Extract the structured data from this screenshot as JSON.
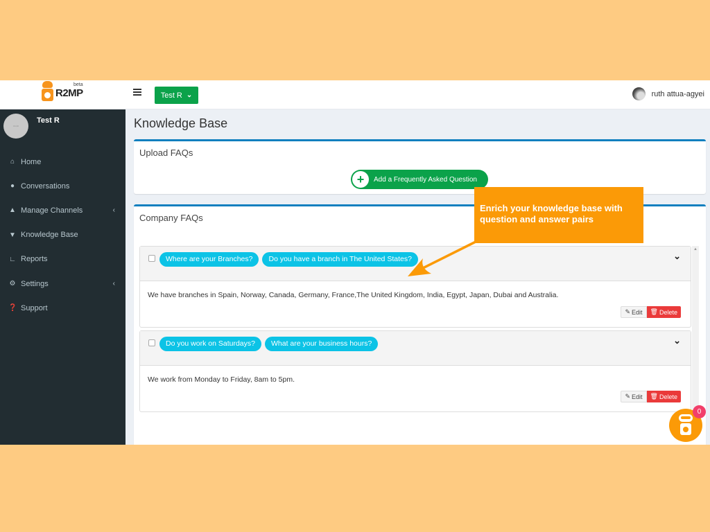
{
  "header": {
    "brand": "R2MP",
    "brand_tag": "beta",
    "team_button": "Test R",
    "user_name": "ruth attua-agyei"
  },
  "sidebar": {
    "profile_name": "Test R",
    "profile_pic_text": "90x90",
    "items": [
      {
        "label": "Home",
        "icon": "home-icon",
        "glyph": "⌂",
        "has_submenu": false
      },
      {
        "label": "Conversations",
        "icon": "comments-icon",
        "glyph": "💬",
        "has_submenu": false
      },
      {
        "label": "Manage Channels",
        "icon": "binoculars-icon",
        "glyph": "⛁",
        "has_submenu": true
      },
      {
        "label": "Knowledge Base",
        "icon": "graduation-cap-icon",
        "glyph": "🎓",
        "has_submenu": false
      },
      {
        "label": "Reports",
        "icon": "line-chart-icon",
        "glyph": "📈",
        "has_submenu": false
      },
      {
        "label": "Settings",
        "icon": "cogs-icon",
        "glyph": "⚙",
        "has_submenu": true
      },
      {
        "label": "Support",
        "icon": "question-circle-icon",
        "glyph": "?",
        "has_submenu": false
      }
    ]
  },
  "main": {
    "page_title": "Knowledge Base",
    "upload_box": {
      "title": "Upload FAQs",
      "add_button": "Add a Frequently Asked Question"
    },
    "faq_box": {
      "title": "Company FAQs",
      "faqs": [
        {
          "questions": [
            "Where are your Branches?",
            "Do you have a branch in The United States?"
          ],
          "answer": "We have branches in Spain, Norway, Canada, Germany, France,The United Kingdom, India, Egypt, Japan, Dubai and Australia.",
          "edit_label": "Edit",
          "delete_label": "Delete"
        },
        {
          "questions": [
            "Do you work on Saturdays?",
            "What are your business hours?"
          ],
          "answer": "We work from Monday to Friday, 8am to 5pm.",
          "edit_label": "Edit",
          "delete_label": "Delete"
        }
      ]
    }
  },
  "tooltip": {
    "text": "Enrich your knowledge base with question and answer pairs"
  },
  "chat_widget": {
    "badge_count": "0"
  },
  "colors": {
    "accent_green": "#0ba24a",
    "pill_cyan": "#0cc3e6",
    "tooltip_orange": "#fb9a07",
    "delete_red": "#ea3a3a",
    "sidebar_bg": "#222d32",
    "box_border_blue": "#0f7fbf"
  }
}
